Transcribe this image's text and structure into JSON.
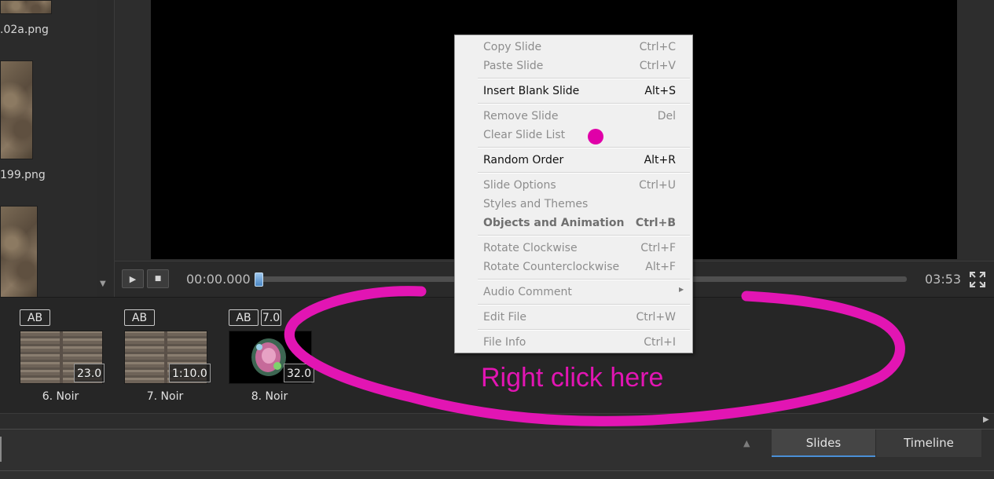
{
  "file_panel": {
    "files": [
      {
        "name": ".02a.png"
      },
      {
        "name": "199.png"
      },
      {
        "name": ""
      }
    ]
  },
  "transport": {
    "play_icon": "play-icon",
    "stop_icon": "stop-icon",
    "current_time": "00:00.000",
    "total_time": "03:53",
    "seek_progress": 0.0,
    "fullscreen_icon": "fullscreen-icon"
  },
  "slides": [
    {
      "badge": "AB",
      "extra_badge": "",
      "duration": "23.0",
      "name": "6. Noir"
    },
    {
      "badge": "AB",
      "extra_badge": "",
      "duration": "1:10.0",
      "name": "7. Noir"
    },
    {
      "badge": "AB",
      "extra_badge": "7.0",
      "duration": "32.0",
      "name": "8. Noir"
    }
  ],
  "context_menu": {
    "items": [
      {
        "label": "Copy Slide",
        "shortcut": "Ctrl+C",
        "enabled": false
      },
      {
        "label": "Paste Slide",
        "shortcut": "Ctrl+V",
        "enabled": false
      },
      {
        "label": "Insert Blank Slide",
        "shortcut": "Alt+S",
        "enabled": true
      },
      {
        "label": "Remove Slide",
        "shortcut": "Del",
        "enabled": false
      },
      {
        "label": "Clear Slide List",
        "shortcut": "",
        "enabled": false
      },
      {
        "label": "Random Order",
        "shortcut": "Alt+R",
        "enabled": true
      },
      {
        "label": "Slide Options",
        "shortcut": "Ctrl+U",
        "enabled": false
      },
      {
        "label": "Styles and Themes",
        "shortcut": "",
        "enabled": false
      },
      {
        "label": "Objects and Animation",
        "shortcut": "Ctrl+B",
        "enabled": false
      },
      {
        "label": "Rotate Clockwise",
        "shortcut": "Ctrl+F",
        "enabled": false
      },
      {
        "label": "Rotate Counterclockwise",
        "shortcut": "Alt+F",
        "enabled": false
      },
      {
        "label": "Audio Comment",
        "shortcut": "",
        "enabled": false
      },
      {
        "label": "Edit File",
        "shortcut": "Ctrl+W",
        "enabled": false
      },
      {
        "label": "File Info",
        "shortcut": "Ctrl+I",
        "enabled": false
      }
    ]
  },
  "tabs": {
    "slides": "Slides",
    "timeline": "Timeline"
  },
  "annotation": {
    "text": "Right click here",
    "color": "#e215b3"
  },
  "colors": {
    "accent": "#4a8fd6",
    "background": "#2f2f2f",
    "menu_bg": "#f0f0f0"
  }
}
